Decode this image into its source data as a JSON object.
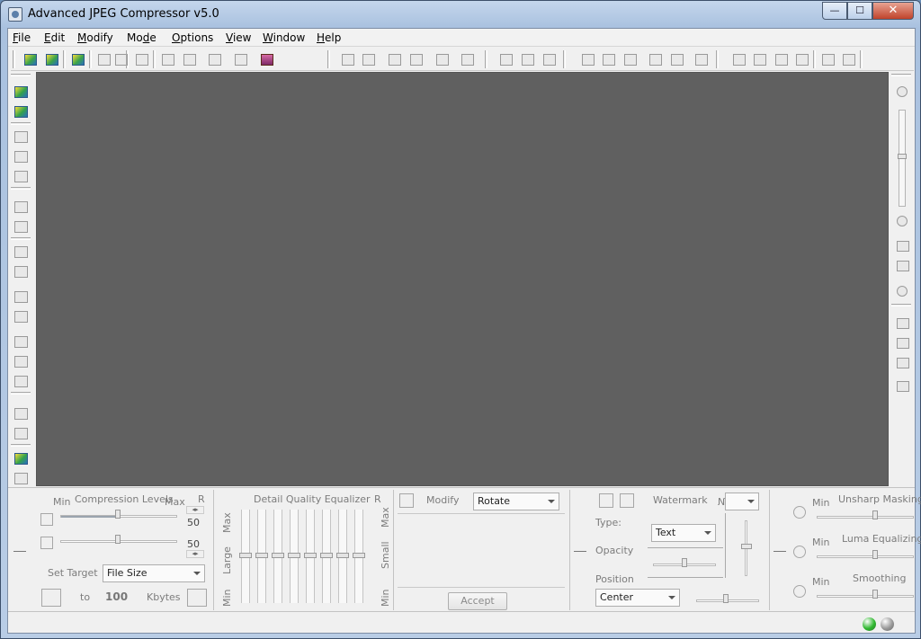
{
  "window": {
    "title": "Advanced JPEG Compressor v5.0",
    "min": "—",
    "max": "☐",
    "close": "✕"
  },
  "menu": [
    {
      "key": "F",
      "rest": "ile"
    },
    {
      "key": "E",
      "rest": "dit"
    },
    {
      "key": "M",
      "rest": "odify"
    },
    {
      "pre": "Mo",
      "key": "d",
      "rest": "e"
    },
    {
      "key": "O",
      "rest": "ptions"
    },
    {
      "key": "V",
      "rest": "iew"
    },
    {
      "key": "W",
      "rest": "indow"
    },
    {
      "key": "H",
      "rest": "elp"
    }
  ],
  "compression": {
    "title": "Compression Levels",
    "min": "Min",
    "max": "Max",
    "r": "R",
    "level1": "50",
    "level2": "50",
    "set_target_label": "Set Target",
    "target_mode": "File Size",
    "to_label": "to",
    "target_value": "100",
    "unit": "Kbytes"
  },
  "equalizer": {
    "title": "Detail Quality Equalizer",
    "r": "R",
    "left_max": "Max",
    "left_large": "Large",
    "left_min": "Min",
    "right_max": "Max",
    "right_small": "Small",
    "right_min": "Min"
  },
  "modify": {
    "label": "Modify",
    "operation": "Rotate",
    "accept": "Accept"
  },
  "watermark": {
    "title": "Watermark",
    "number_label": "№",
    "number_value": "",
    "type_label": "Type:",
    "type_value": "Text",
    "opacity_label": "Opacity",
    "position_label": "Position",
    "position_value": "Center"
  },
  "filters": [
    {
      "min": "Min",
      "name": "Unsharp Masking"
    },
    {
      "min": "Min",
      "name": "Luma Equalizing"
    },
    {
      "min": "Min",
      "name": "Smoothing"
    }
  ],
  "status": {
    "led1": "#2fb82f",
    "led2": "#9a9a9a"
  }
}
